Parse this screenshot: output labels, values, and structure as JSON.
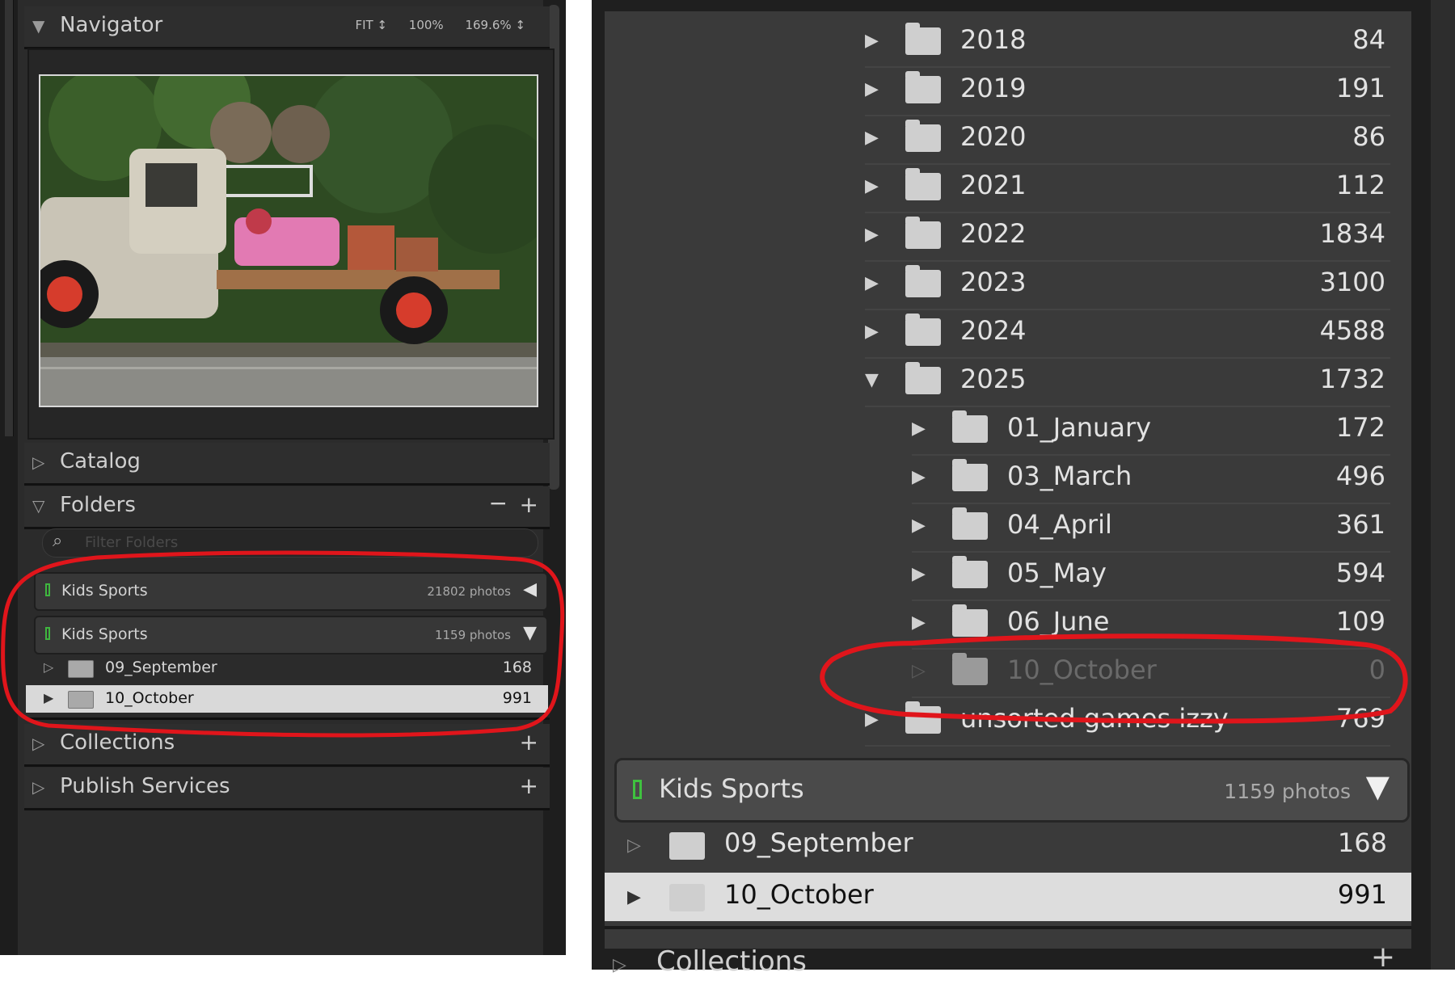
{
  "left": {
    "navigator": {
      "title": "Navigator",
      "zoom_options": [
        "FIT ↕",
        "100%",
        "169.6% ↕"
      ]
    },
    "catalog": {
      "title": "Catalog"
    },
    "folders": {
      "title": "Folders",
      "minus": "−",
      "plus": "+",
      "search_placeholder": "Filter Folders",
      "sources": [
        {
          "name": "Kids Sports",
          "count": "21802 photos",
          "arrow": "◀"
        },
        {
          "name": "Kids Sports",
          "count": "1159 photos",
          "arrow": "▼"
        }
      ],
      "rows": [
        {
          "toggle": "▷",
          "name": "09_September",
          "count": "168"
        },
        {
          "toggle": "▶",
          "name": "10_October",
          "count": "991"
        }
      ]
    },
    "collections": {
      "title": "Collections",
      "plus": "+"
    },
    "publish": {
      "title": "Publish Services",
      "plus": "+"
    }
  },
  "right": {
    "years": [
      {
        "toggle": "▶",
        "name": "2018",
        "count": "84"
      },
      {
        "toggle": "▶",
        "name": "2019",
        "count": "191"
      },
      {
        "toggle": "▶",
        "name": "2020",
        "count": "86"
      },
      {
        "toggle": "▶",
        "name": "2021",
        "count": "112"
      },
      {
        "toggle": "▶",
        "name": "2022",
        "count": "1834"
      },
      {
        "toggle": "▶",
        "name": "2023",
        "count": "3100"
      },
      {
        "toggle": "▶",
        "name": "2024",
        "count": "4588"
      },
      {
        "toggle": "▼",
        "name": "2025",
        "count": "1732"
      }
    ],
    "months": [
      {
        "toggle": "▶",
        "name": "01_January",
        "count": "172"
      },
      {
        "toggle": "▶",
        "name": "03_March",
        "count": "496"
      },
      {
        "toggle": "▶",
        "name": "04_April",
        "count": "361"
      },
      {
        "toggle": "▶",
        "name": "05_May",
        "count": "594"
      },
      {
        "toggle": "▶",
        "name": "06_June",
        "count": "109"
      },
      {
        "toggle": "▷",
        "name": "10_October",
        "count": "0"
      }
    ],
    "unsorted": {
      "toggle": "▶",
      "name": "unsorted games izzy",
      "count": "769"
    },
    "source": {
      "name": "Kids Sports",
      "count": "1159 photos",
      "arrow": "▼"
    },
    "rows": [
      {
        "toggle": "▷",
        "name": "09_September",
        "count": "168"
      },
      {
        "toggle": "▶",
        "name": "10_October",
        "count": "991"
      }
    ],
    "collections": {
      "title": "Collections",
      "plus": "+"
    }
  },
  "colors": {
    "annotation": "#e0151b",
    "panel": "#2b2b2b",
    "selected_row": "#d9d9d9",
    "source_marker": "#3fb63f"
  }
}
